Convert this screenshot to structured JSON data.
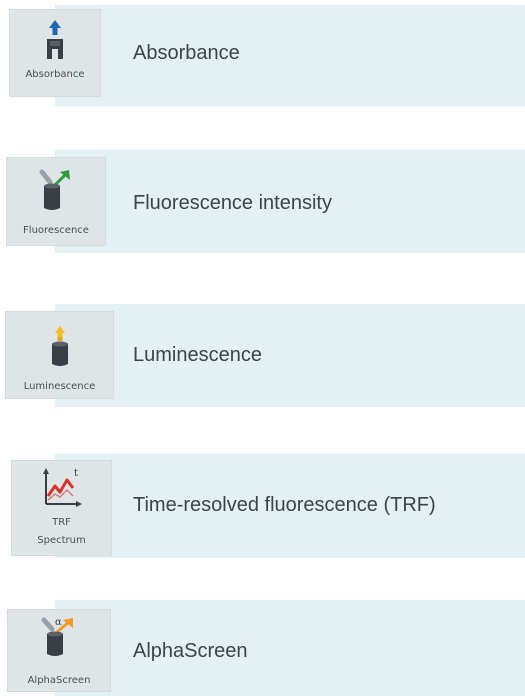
{
  "colors": {
    "band": "#e3f1f4",
    "tile": "#dfe4e7",
    "text": "#3e4348",
    "absorbance_arrow": "#1f67b5",
    "fluorescence_arrow": "#2e9a3e",
    "luminescence_glow": "#f0c020",
    "trf_curve": "#d9342b",
    "alpha_arrow": "#f39a2d"
  },
  "modes": [
    {
      "tile_label": "Absorbance",
      "title": "Absorbance",
      "icon": "absorbance-icon"
    },
    {
      "tile_label": "Fluorescence",
      "title": "Fluorescence intensity",
      "icon": "fluorescence-icon"
    },
    {
      "tile_label": "Luminescence",
      "title": "Luminescence",
      "icon": "luminescence-icon"
    },
    {
      "tile_label_line1": "TRF",
      "tile_label_line2": "Spectrum",
      "title": "Time-resolved fluorescence (TRF)",
      "icon": "trf-spectrum-icon",
      "icon_symbol": "t"
    },
    {
      "tile_label": "AlphaScreen",
      "title": "AlphaScreen",
      "icon": "alphascreen-icon",
      "icon_symbol": "α"
    }
  ]
}
